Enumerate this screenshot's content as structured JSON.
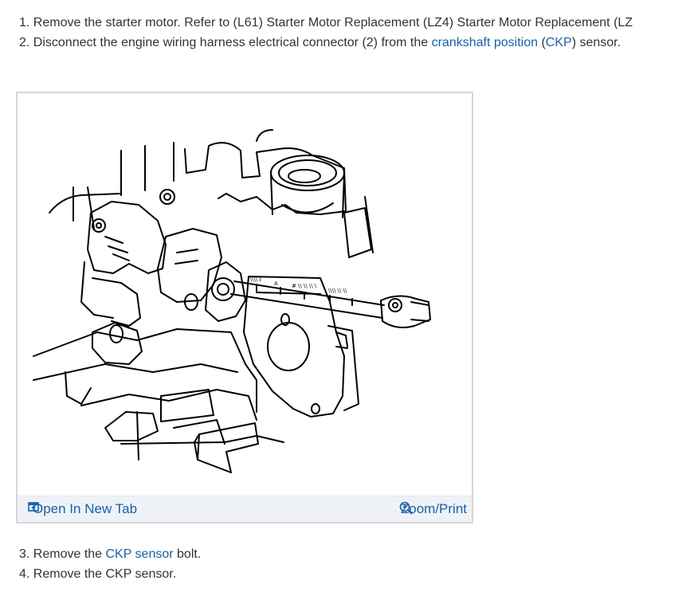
{
  "steps": [
    {
      "num": "1.",
      "pre": " Remove the starter motor. Refer to (L61) Starter Motor Replacement (LZ4) Starter Motor Replacement (LZ"
    },
    {
      "num": "2.",
      "pre": " Disconnect the engine wiring harness electrical connector (2) from the ",
      "link1": "crankshaft position",
      "mid": " (",
      "link2": "CKP",
      "post": ") sensor."
    },
    {
      "num": "3.",
      "pre": " Remove the ",
      "link1": "CKP sensor",
      "post": " bolt."
    },
    {
      "num": "4.",
      "pre": " Remove the CKP sensor."
    }
  ],
  "figure": {
    "open_label": "Open In New Tab",
    "zoom_label": "Zoom/Print",
    "illustration_labels": {
      "a": "\\\\\\\\ I",
      "b": "A",
      "c": "# \\\\ \\\\ \\\\ \\",
      "d": "\\\\\\\\ \\\\ \\\\"
    }
  },
  "colors": {
    "text": "#333333",
    "link": "#1a5fa8",
    "bar_bg": "#eef2f6",
    "border": "#d6d6d6"
  },
  "icons": {
    "open": "open-in-new-tab-icon",
    "zoom": "zoom-in-icon"
  }
}
